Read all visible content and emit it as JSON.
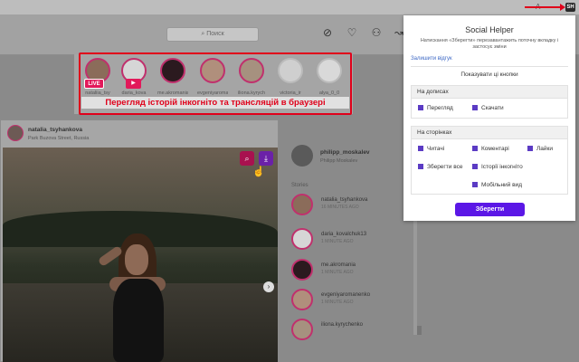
{
  "browser": {
    "extension_badge": "SH"
  },
  "ig": {
    "search_placeholder": "Поиск",
    "stories": [
      {
        "name": "nataliia_tsy"
      },
      {
        "name": "daria_kova"
      },
      {
        "name": "me.akromania"
      },
      {
        "name": "evgeniyaroma"
      },
      {
        "name": "iliona.kyrych"
      },
      {
        "name": "victoria_ir"
      },
      {
        "name": "alya_0_0"
      }
    ],
    "live_label": "LIVE",
    "callout_text": "Перегляд історій інкогніто та трансляцій в браузері",
    "post": {
      "username": "natalia_tsyhankova",
      "location": "Park Buzova Street, Russia"
    },
    "sidebar": {
      "me_name": "philipp_moskalev",
      "me_sub": "Philipp Moskalev",
      "stories_label": "Stories",
      "items": [
        {
          "name": "natalia_tsyhankova",
          "time": "16 MINUTES AGO"
        },
        {
          "name": "daria_kovalchuk13",
          "time": "1 MINUTE AGO"
        },
        {
          "name": "me.akromania",
          "time": "1 MINUTE AGO"
        },
        {
          "name": "evgeniyaromanenko",
          "time": "1 MINUTE AGO"
        },
        {
          "name": "iliona.kyrychenko",
          "time": ""
        }
      ]
    }
  },
  "popup": {
    "title": "Social Helper",
    "description": "Натискання «Зберегти» перезавантажить поточну вкладку і застосує зміни",
    "feedback_link": "Залишити відгук",
    "show_buttons_label": "Показувати ці кнопки",
    "posts_section": {
      "header": "На дописах",
      "options": [
        {
          "label": "Перегляд"
        },
        {
          "label": "Скачати"
        }
      ]
    },
    "pages_section": {
      "header": "На сторінках",
      "options": [
        {
          "label": "Читачі"
        },
        {
          "label": "Коментарі"
        },
        {
          "label": "Лайки"
        },
        {
          "label": "Зберегти все"
        },
        {
          "label": "Історії інкогніто"
        },
        {
          "label": "Мобільний вид"
        }
      ]
    },
    "save_button": "Зберегти"
  },
  "colors": {
    "accent": "#5b17e6",
    "checkbox": "#5b3bc4",
    "callout": "#e0001a",
    "story_ring": "#c0306d"
  },
  "icons": [
    "compass-icon",
    "home-icon",
    "user-icon",
    "search-icon",
    "download-icon",
    "chevron-right-icon"
  ]
}
